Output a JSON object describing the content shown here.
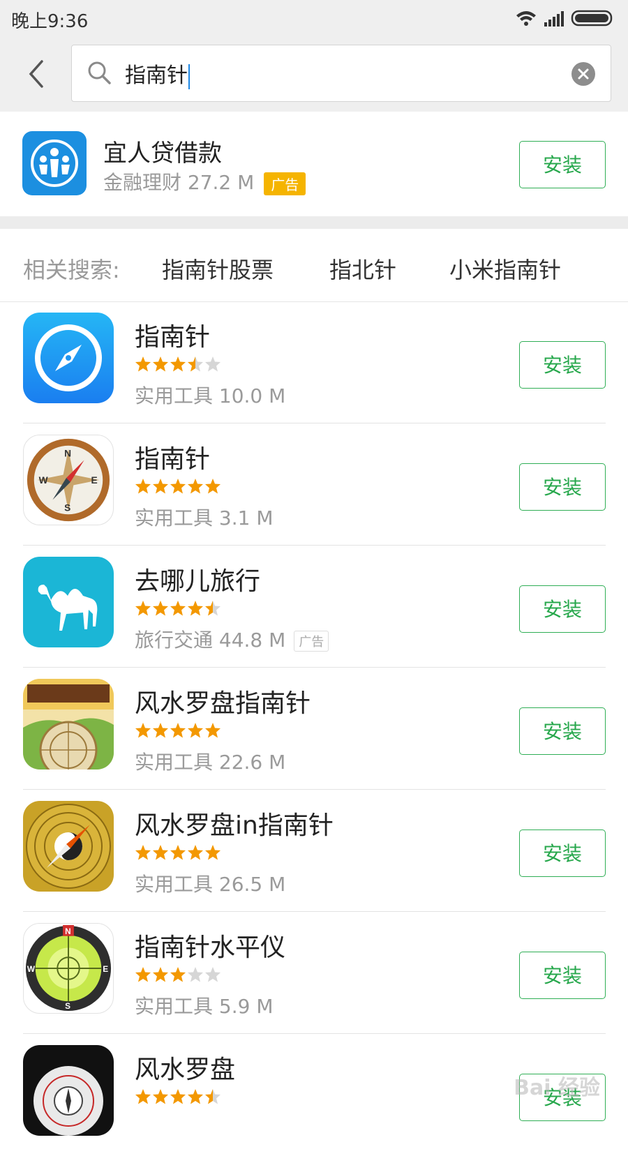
{
  "status_bar": {
    "time": "晚上9:36"
  },
  "search": {
    "query": "指南针"
  },
  "ad_app": {
    "name": "宜人贷借款",
    "meta": "金融理财 27.2 M",
    "ad_label": "广告",
    "install_label": "安装"
  },
  "related": {
    "label": "相关搜索:",
    "keywords": [
      "指南针股票",
      "指北针",
      "小米指南针"
    ]
  },
  "apps": [
    {
      "name": "指南针",
      "rating": 3.5,
      "meta": "实用工具 10.0 M",
      "ad_label": "",
      "install_label": "安装"
    },
    {
      "name": "指南针",
      "rating": 5,
      "meta": "实用工具 3.1 M",
      "ad_label": "",
      "install_label": "安装"
    },
    {
      "name": "去哪儿旅行",
      "rating": 4.5,
      "meta": "旅行交通 44.8 M",
      "ad_label": "广告",
      "install_label": "安装"
    },
    {
      "name": "风水罗盘指南针",
      "rating": 5,
      "meta": "实用工具 22.6 M",
      "ad_label": "",
      "install_label": "安装"
    },
    {
      "name": "风水罗盘in指南针",
      "rating": 5,
      "meta": "实用工具 26.5 M",
      "ad_label": "",
      "install_label": "安装"
    },
    {
      "name": "指南针水平仪",
      "rating": 3,
      "meta": "实用工具 5.9 M",
      "ad_label": "",
      "install_label": "安装"
    },
    {
      "name": "风水罗盘",
      "rating": 4.5,
      "meta": "",
      "ad_label": "",
      "install_label": "安装"
    }
  ],
  "icons": [
    "wifi-icon",
    "signal-icon",
    "battery-icon",
    "back-icon",
    "search-icon",
    "clear-icon",
    "yirendai-icon",
    "compass-blue-icon",
    "compass-classic-icon",
    "camel-icon",
    "fengshui-compass-icon",
    "bagua-compass-icon",
    "level-compass-icon",
    "black-compass-icon"
  ],
  "colors": {
    "accent_green": "#28a84d",
    "star": "#f39800",
    "ad_badge": "#f5b400"
  },
  "watermark": "Bai 经验"
}
